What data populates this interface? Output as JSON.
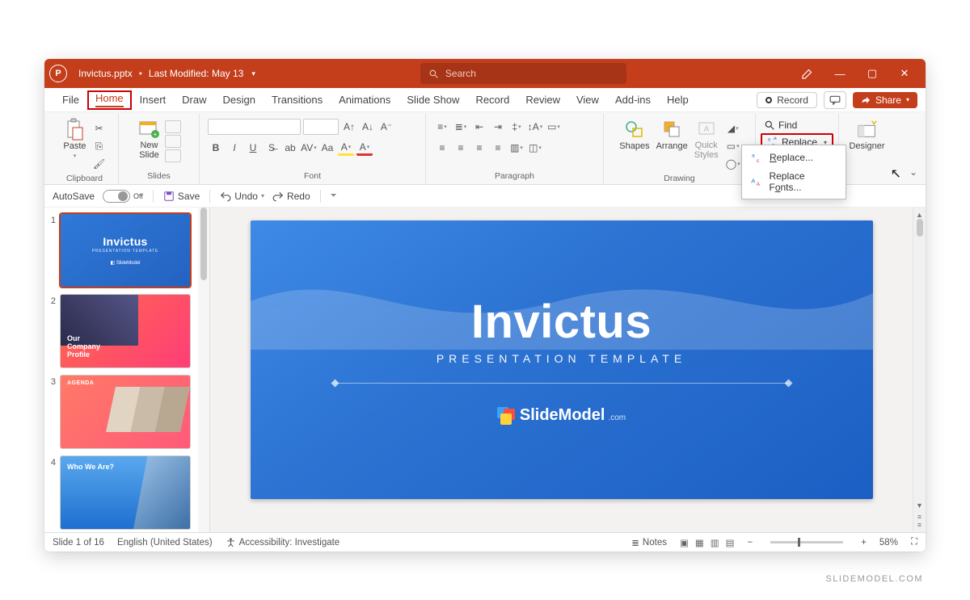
{
  "titlebar": {
    "filename": "Invictus.pptx",
    "modified": "Last Modified: May 13",
    "search_placeholder": "Search"
  },
  "window_controls": {
    "minimize": "—",
    "maximize": "▢",
    "close": "✕"
  },
  "tabs": {
    "file": "File",
    "home": "Home",
    "insert": "Insert",
    "draw": "Draw",
    "design": "Design",
    "transitions": "Transitions",
    "animations": "Animations",
    "slideshow": "Slide Show",
    "record": "Record",
    "review": "Review",
    "view": "View",
    "addins": "Add-ins",
    "help": "Help"
  },
  "tab_actions": {
    "record_btn": "Record",
    "share_btn": "Share"
  },
  "ribbon": {
    "clipboard": {
      "paste": "Paste",
      "label": "Clipboard"
    },
    "slides": {
      "new_slide": "New\nSlide",
      "label": "Slides"
    },
    "font": {
      "label": "Font"
    },
    "paragraph": {
      "label": "Paragraph"
    },
    "drawing": {
      "shapes": "Shapes",
      "arrange": "Arrange",
      "quick": "Quick\nStyles",
      "label": "Drawing"
    },
    "editing": {
      "find": "Find",
      "replace": "Replace",
      "menu_replace": "Replace...",
      "menu_fonts": "Replace Fonts..."
    },
    "designer": {
      "label": "Designer"
    }
  },
  "qat": {
    "autosave": "AutoSave",
    "autosave_state": "Off",
    "save": "Save",
    "undo": "Undo",
    "redo": "Redo"
  },
  "thumbnails": [
    {
      "n": "1",
      "title": "Invictus",
      "sub": "PRESENTATION TEMPLATE",
      "logo": "SlideModel"
    },
    {
      "n": "2",
      "text": "Our\nCompany\nProfile"
    },
    {
      "n": "3",
      "text": "AGENDA"
    },
    {
      "n": "4",
      "text": "Who We Are?"
    }
  ],
  "slide": {
    "title": "Invictus",
    "subtitle": "PRESENTATION TEMPLATE",
    "brand": "SlideModel",
    "brand_suffix": ".com"
  },
  "status": {
    "slide_of": "Slide 1 of 16",
    "lang": "English (United States)",
    "access": "Accessibility: Investigate",
    "notes": "Notes",
    "zoom": "58%"
  },
  "watermark": "SLIDEMODEL.COM"
}
